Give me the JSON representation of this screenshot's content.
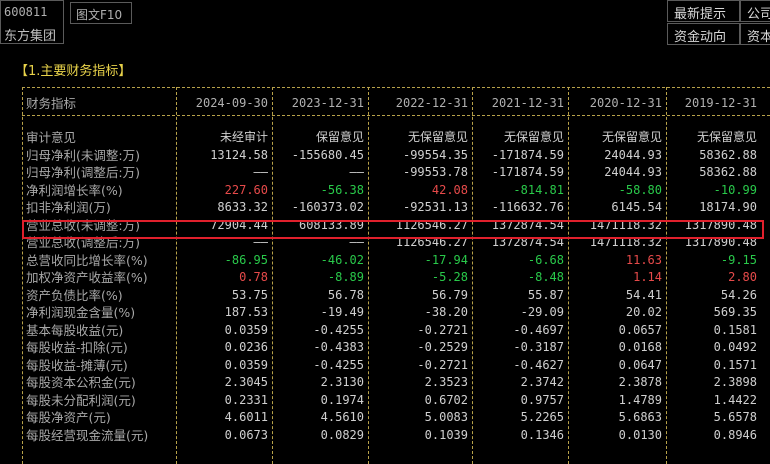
{
  "stock": {
    "code": "600811",
    "name": "东方集团",
    "tab": "图文F10"
  },
  "nav": {
    "latest": "最新提示",
    "company": "公司",
    "funds": "资金动向",
    "capital": "资本"
  },
  "section": {
    "title": "【1.主要财务指标】"
  },
  "table": {
    "label_header": "财务指标",
    "columns": [
      "2024-09-30",
      "2023-12-31",
      "2022-12-31",
      "2021-12-31",
      "2020-12-31",
      "2019-12-31"
    ],
    "rows": [
      {
        "label": "审计意见",
        "values": [
          "未经审计",
          "保留意见",
          "无保留意见",
          "无保留意见",
          "无保留意见",
          "无保留意见"
        ],
        "colors": [
          "w",
          "w",
          "w",
          "w",
          "w",
          "w"
        ]
      },
      {
        "label": "归母净利(未调整:万)",
        "values": [
          "13124.58",
          "-155680.45",
          "-99554.35",
          "-171874.59",
          "24044.93",
          "58362.88"
        ],
        "colors": [
          "w",
          "w",
          "w",
          "w",
          "w",
          "w"
        ]
      },
      {
        "label": "归母净利(调整后:万)",
        "values": [
          "——",
          "——",
          "-99553.78",
          "-171874.59",
          "24044.93",
          "58362.88"
        ],
        "colors": [
          "w",
          "w",
          "w",
          "w",
          "w",
          "w"
        ]
      },
      {
        "label": "净利润增长率(%)",
        "values": [
          "227.60",
          "-56.38",
          "42.08",
          "-814.81",
          "-58.80",
          "-10.99"
        ],
        "colors": [
          "r",
          "g",
          "r",
          "g",
          "g",
          "g"
        ]
      },
      {
        "label": "扣非净利润(万)",
        "values": [
          "8633.32",
          "-160373.02",
          "-92531.13",
          "-116632.76",
          "6145.54",
          "18174.90"
        ],
        "colors": [
          "w",
          "w",
          "w",
          "w",
          "w",
          "w"
        ]
      },
      {
        "label": "营业总收(未调整:万)",
        "values": [
          "72904.44",
          "608133.89",
          "1126546.27",
          "1372874.54",
          "1471118.32",
          "1317890.48"
        ],
        "colors": [
          "w",
          "w",
          "w",
          "w",
          "w",
          "w"
        ]
      },
      {
        "label": "营业总收(调整后:万)",
        "values": [
          "——",
          "——",
          "1126546.27",
          "1372874.54",
          "1471118.32",
          "1317890.48"
        ],
        "colors": [
          "w",
          "w",
          "w",
          "w",
          "w",
          "w"
        ]
      },
      {
        "label": "总营收同比增长率(%)",
        "values": [
          "-86.95",
          "-46.02",
          "-17.94",
          "-6.68",
          "11.63",
          "-9.15"
        ],
        "colors": [
          "g",
          "g",
          "g",
          "g",
          "r",
          "g"
        ]
      },
      {
        "label": "加权净资产收益率(%)",
        "values": [
          "0.78",
          "-8.89",
          "-5.28",
          "-8.48",
          "1.14",
          "2.80"
        ],
        "colors": [
          "r",
          "g",
          "g",
          "g",
          "r",
          "r"
        ]
      },
      {
        "label": "资产负债比率(%)",
        "values": [
          "53.75",
          "56.78",
          "56.79",
          "55.87",
          "54.41",
          "54.26"
        ],
        "colors": [
          "w",
          "w",
          "w",
          "w",
          "w",
          "w"
        ]
      },
      {
        "label": "净利润现金含量(%)",
        "values": [
          "187.53",
          "-19.49",
          "-38.20",
          "-29.09",
          "20.02",
          "569.35"
        ],
        "colors": [
          "w",
          "w",
          "w",
          "w",
          "w",
          "w"
        ]
      },
      {
        "label": "基本每股收益(元)",
        "values": [
          "0.0359",
          "-0.4255",
          "-0.2721",
          "-0.4697",
          "0.0657",
          "0.1581"
        ],
        "colors": [
          "w",
          "w",
          "w",
          "w",
          "w",
          "w"
        ]
      },
      {
        "label": "每股收益-扣除(元)",
        "values": [
          "0.0236",
          "-0.4383",
          "-0.2529",
          "-0.3187",
          "0.0168",
          "0.0492"
        ],
        "colors": [
          "w",
          "w",
          "w",
          "w",
          "w",
          "w"
        ]
      },
      {
        "label": "每股收益-摊薄(元)",
        "values": [
          "0.0359",
          "-0.4255",
          "-0.2721",
          "-0.4627",
          "0.0647",
          "0.1571"
        ],
        "colors": [
          "w",
          "w",
          "w",
          "w",
          "w",
          "w"
        ]
      },
      {
        "label": "每股资本公积金(元)",
        "values": [
          "2.3045",
          "2.3130",
          "2.3523",
          "2.3742",
          "2.3878",
          "2.3898"
        ],
        "colors": [
          "w",
          "w",
          "w",
          "w",
          "w",
          "w"
        ]
      },
      {
        "label": "每股未分配利润(元)",
        "values": [
          "0.2331",
          "0.1974",
          "0.6702",
          "0.9757",
          "1.4789",
          "1.4422"
        ],
        "colors": [
          "w",
          "w",
          "w",
          "w",
          "w",
          "w"
        ]
      },
      {
        "label": "每股净资产(元)",
        "values": [
          "4.6011",
          "4.5610",
          "5.0083",
          "5.2265",
          "5.6863",
          "5.6578"
        ],
        "colors": [
          "w",
          "w",
          "w",
          "w",
          "w",
          "w"
        ]
      },
      {
        "label": "每股经营现金流量(元)",
        "values": [
          "0.0673",
          "0.0829",
          "0.1039",
          "0.1346",
          "0.0130",
          "0.8946"
        ],
        "colors": [
          "w",
          "w",
          "w",
          "w",
          "w",
          "w"
        ]
      }
    ]
  }
}
